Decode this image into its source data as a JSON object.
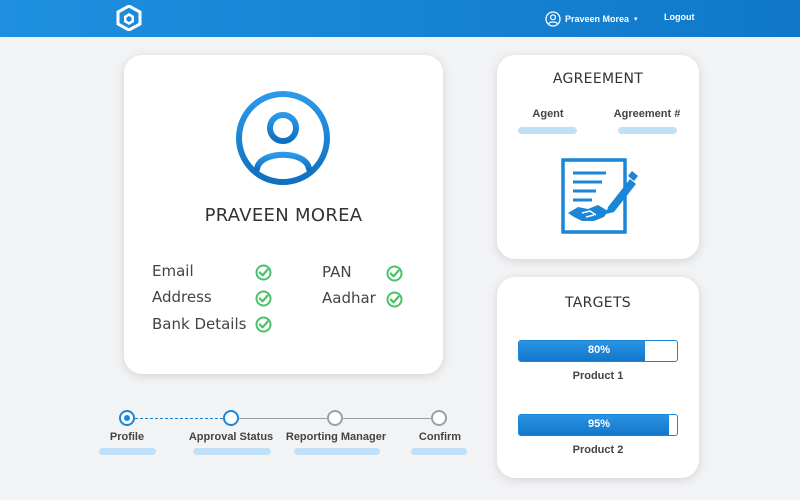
{
  "header": {
    "user_name": "Praveen Morea",
    "user_caret": "▾",
    "logout_label": "Logout"
  },
  "profile": {
    "name": "PRAVEEN MOREA",
    "checks_left": [
      "Email",
      "Address",
      "Bank Details"
    ],
    "checks_right": [
      "PAN",
      "Aadhar"
    ]
  },
  "agreement": {
    "title": "AGREEMENT",
    "col_agent": "Agent",
    "col_number": "Agreement #"
  },
  "targets": {
    "title": "TARGETS",
    "items": [
      {
        "label": "Product 1",
        "percent_text": "80%",
        "percent": 80
      },
      {
        "label": "Product 2",
        "percent_text": "95%",
        "percent": 95
      }
    ]
  },
  "stepper": {
    "steps": [
      {
        "label": "Profile",
        "state": "active"
      },
      {
        "label": "Approval Status",
        "state": "next"
      },
      {
        "label": "Reporting Manager",
        "state": "pending"
      },
      {
        "label": "Confirm",
        "state": "pending"
      }
    ]
  },
  "colors": {
    "brand_blue": "#1a86d8",
    "check_green": "#4cc06a",
    "pill_light_blue": "#bfe0f7"
  },
  "icons": {
    "logo": "hexagon-logo-icon",
    "user": "user-circle-icon",
    "check": "check-circle-icon",
    "agreement": "agreement-document-icon"
  }
}
